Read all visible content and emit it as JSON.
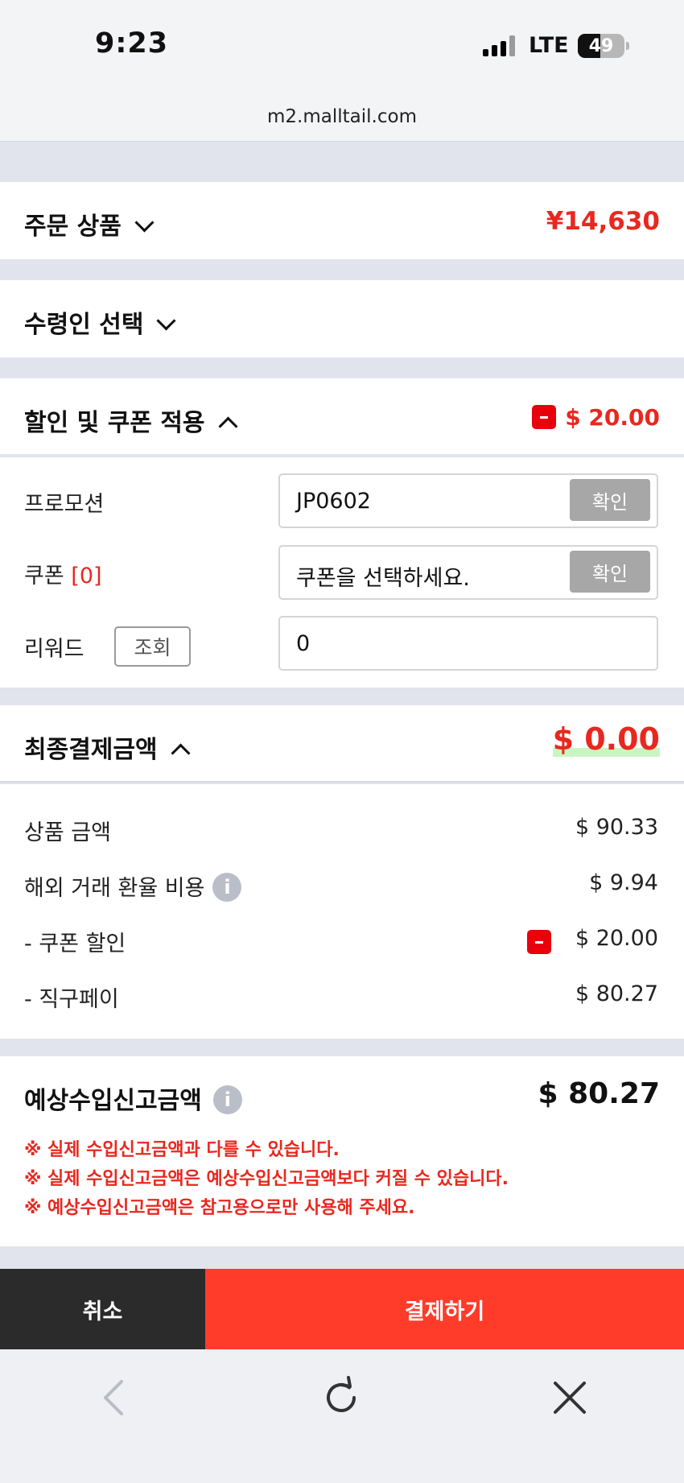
{
  "status_bar": {
    "time": "9:23",
    "network": "LTE",
    "battery": "49",
    "battery_level": 0.49
  },
  "browser": {
    "url": "m2.malltail.com"
  },
  "order_items": {
    "title": "주문 상품",
    "amount": "¥14,630"
  },
  "recipient": {
    "title": "수령인 선택"
  },
  "discount": {
    "title": "할인 및 쿠폰 적용",
    "amount": "$ 20.00",
    "promotion": {
      "label": "프로모션",
      "value": "JP0602",
      "button": "확인"
    },
    "coupon": {
      "label": "쿠폰",
      "count": "[0]",
      "value": "쿠폰을 선택하세요.",
      "button": "확인"
    },
    "reward": {
      "label": "리워드",
      "lookup_button": "조회",
      "value": "0"
    }
  },
  "final_payment": {
    "title": "최종결제금액",
    "amount": "$ 0.00",
    "rows": [
      {
        "label": "상품 금액",
        "value": "$ 90.33"
      },
      {
        "label": "해외 거래 환율 비용",
        "value": "$ 9.94"
      },
      {
        "label": "- 쿠폰 할인",
        "value": "$ 20.00"
      },
      {
        "label": "- 직구페이",
        "value": "$ 80.27"
      }
    ]
  },
  "customs": {
    "title": "예상수입신고금액",
    "amount": "$ 80.27",
    "notices": [
      "※ 실제 수입신고금액과 다를 수 있습니다.",
      "※ 실제 수입신고금액은 예상수입신고금액보다 커질 수 있습니다.",
      "※ 예상수입신고금액은 참고용으로만 사용해 주세요."
    ]
  },
  "actions": {
    "cancel": "취소",
    "pay": "결제하기"
  },
  "colors": {
    "accent_red": "#e8281f",
    "pay_button": "#ff3b2a",
    "cancel_button": "#2b2b2b",
    "disabled_button": "#a7a7a7"
  },
  "icons": [
    "back-icon",
    "reload-icon",
    "close-icon",
    "info-icon",
    "minus-icon",
    "chevron-down-icon",
    "chevron-up-icon"
  ]
}
